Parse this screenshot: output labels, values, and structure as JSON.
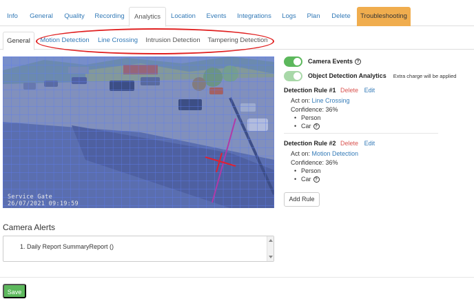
{
  "top_tabs": [
    "Info",
    "General",
    "Quality",
    "Recording",
    "Analytics",
    "Location",
    "Events",
    "Integrations",
    "Logs",
    "Plan",
    "Delete",
    "Troubleshooting"
  ],
  "active_top_tab": "Analytics",
  "sub_tabs": [
    "General",
    "Motion Detection",
    "Line Crossing",
    "Intrusion Detection",
    "Tampering Detection"
  ],
  "active_sub_tab": "General",
  "camera": {
    "overlay_name": "Service Gate",
    "overlay_timestamp": "26/07/2021 09:19:59"
  },
  "settings": {
    "camera_events_label": "Camera Events",
    "camera_events_on": true,
    "object_detection_label": "Object Detection Analytics",
    "object_detection_on": true,
    "extra_charge_note": "Extra charge will be applied",
    "help_icon": "question-circle-icon"
  },
  "rules": [
    {
      "title": "Detection Rule #1",
      "delete_label": "Delete",
      "edit_label": "Edit",
      "act_on_label": "Act on:",
      "act_on_value": "Line Crossing",
      "confidence": "Confidence: 36%",
      "objects": [
        "Person",
        "Car"
      ]
    },
    {
      "title": "Detection Rule #2",
      "delete_label": "Delete",
      "edit_label": "Edit",
      "act_on_label": "Act on:",
      "act_on_value": "Motion Detection",
      "confidence": "Confidence: 36%",
      "objects": [
        "Person",
        "Car"
      ]
    }
  ],
  "add_rule_label": "Add Rule",
  "alerts": {
    "title": "Camera Alerts",
    "items": [
      "1. Daily Report SummaryReport ()"
    ]
  },
  "save_label": "Save",
  "colors": {
    "link": "#337ab7",
    "delete": "#d9534f",
    "toggle_on": "#5cb85c",
    "troubleshooting_tab": "#f0ad4e",
    "highlight_ellipse": "#e02020",
    "grid_overlay": "#4f6fe8"
  }
}
